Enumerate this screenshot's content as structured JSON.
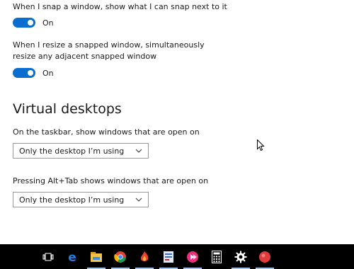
{
  "snap": {
    "option1_text": "When I snap a window, show what I can snap next to it",
    "option1_state": "On",
    "option2_text": "When I resize a snapped window, simultaneously resize any adjacent snapped window",
    "option2_state": "On"
  },
  "virtual_desktops": {
    "title": "Virtual desktops",
    "taskbar_label": "On the taskbar, show windows that are open on",
    "taskbar_value": "Only the desktop I’m using",
    "alttab_label": "Pressing Alt+Tab shows windows that are open on",
    "alttab_value": "Only the desktop I’m using"
  },
  "colors": {
    "accent": "#0a6ed1",
    "taskbar": "#000000"
  },
  "taskbar": {
    "icons": [
      "task-view-icon",
      "edge-icon",
      "file-explorer-icon",
      "chrome-icon",
      "app-red-flame-icon",
      "app-document-icon",
      "app-pink-arrow-icon",
      "calculator-icon",
      "settings-gear-icon",
      "recorder-icon"
    ]
  }
}
